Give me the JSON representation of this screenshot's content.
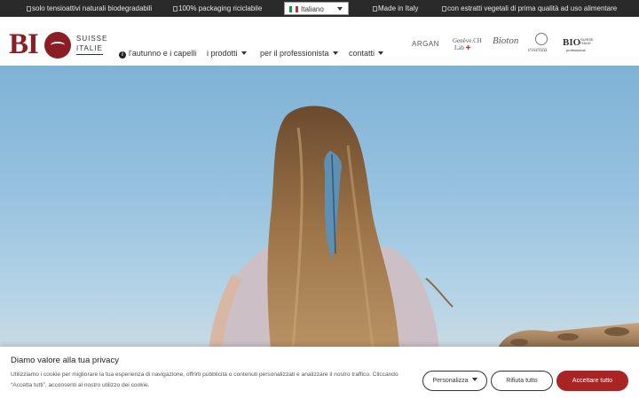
{
  "topbar": {
    "usps": [
      "solo tensioattivi naturali biodegradabili",
      "100% packaging riciclabile",
      "Made in Italy",
      "con estratti vegetali di prima qualità ad uso alimentare"
    ],
    "language": "Italiano"
  },
  "header": {
    "logo": {
      "main": "BIO",
      "line1": "SUISSE",
      "line2": "ITALIE"
    },
    "nav": [
      {
        "label": "l'autunno e i capelli"
      },
      {
        "label": "i prodotti"
      },
      {
        "label": "per il professionista"
      },
      {
        "label": "contatti"
      }
    ],
    "brands": {
      "argan": "ARGAN",
      "geneve_1": "Genève.CH",
      "geneve_2": "Lab",
      "bioton": "Bioton",
      "essenza": "essenza",
      "bio_main": "BIO",
      "bio_sub_1": "SUISSE",
      "bio_sub_2": "ITALIE",
      "bio_pro": "professional"
    }
  },
  "colors": {
    "brand_red": "#8b1e24",
    "accept_button": "#a92525",
    "topbar_bg": "#2a2a2a"
  },
  "cookie": {
    "title": "Diamo valore alla tua privacy",
    "text": "Utilizziamo i cookie per migliorare la tua esperienza di navigazione, offrirti pubblicità o contenuti personalizzati e analizzare il nostro traffico. Cliccando “Accetta tutti”, acconsenti al nostro utilizzo dei cookie.",
    "customize": "Personalizza",
    "reject": "Rifiuta tutto",
    "accept": "Accettare tutto"
  }
}
